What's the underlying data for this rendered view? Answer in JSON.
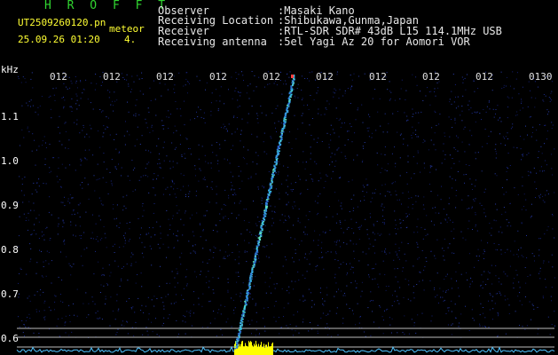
{
  "header": {
    "title": "H R O F F T",
    "filename": "UT2509260120.pn",
    "event_type": "meteor",
    "datetime": "25.09.26 01:20",
    "count": "4.",
    "fields": [
      {
        "label": "Observer",
        "value": ":Masaki Kano"
      },
      {
        "label": "Receiving Location",
        "value": ":Shibukawa,Gunma,Japan"
      },
      {
        "label": "Receiver",
        "value": ":RTL-SDR SDR# 43dB L15 114.1MHz USB"
      },
      {
        "label": "Receiving antenna",
        "value": ":5el Yagi Az 20 for Aomori VOR"
      }
    ]
  },
  "axis": {
    "unit": "kHz",
    "time_ticks": [
      "012",
      "012",
      "012",
      "012",
      "012",
      "012",
      "012",
      "012",
      "012",
      "0130"
    ],
    "freq_ticks": [
      "1.1",
      "1.0",
      "0.9",
      "0.8",
      "0.7",
      "0.6"
    ]
  },
  "colors": {
    "background": "#000000",
    "header_text": "#ffffff",
    "title": "#31d631",
    "filename": "#ffff33",
    "noise": "#1a2a8c",
    "trail": "#39c6e8",
    "baseline": "#4fc3ff",
    "signal": "#ffff00"
  }
}
